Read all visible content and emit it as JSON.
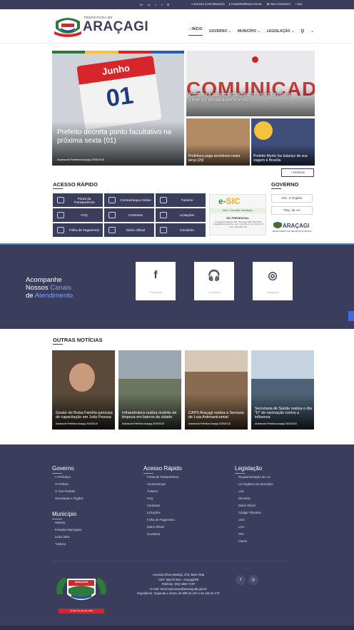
{
  "colors": {
    "brand": "#3a3e5c",
    "accent": "#7da4ff",
    "red": "#d6262b"
  },
  "topbar": {
    "accessibility": [
      "A+",
      "A-",
      "◐",
      "◑",
      "☰"
    ],
    "links": [
      {
        "icon": "info-icon",
        "label": "ACESSO À INFORMAÇÃO"
      },
      {
        "icon": "chart-icon",
        "label": "TRANSPARÊNCIA FISCAL"
      },
      {
        "icon": "phone-icon",
        "label": "FALE CONOSCO"
      },
      {
        "icon": "help-icon",
        "label": "FAQ"
      }
    ]
  },
  "header": {
    "prefix": "PREFEITURA DE",
    "city": "ARAÇAGI",
    "nav": [
      "INÍCIO",
      "GOVERNO",
      "MUNICÍPIO",
      "LEGISLAÇÃO"
    ]
  },
  "hero": {
    "main": {
      "calendar_month": "Junho",
      "calendar_day": "01",
      "title": "Prefeito decreta ponto facultativo na próxima sexta (01)",
      "meta": "Assessoria Prefeitura Araçagi 30/05/2018"
    },
    "right_top": {
      "bg_text": "COMUNICADO",
      "title": "Prefeitura suspende alguns serviços devido a crise do desabastecimento"
    },
    "right_bottom_left": {
      "title": "Prefeitura paga servidores nesta terça (29)"
    },
    "right_bottom_right": {
      "title": "Prefeito Murilo faz balanço de sua viagem à Brasília"
    },
    "all_news": "+ Notícias"
  },
  "acesso_rapido": {
    "title": "ACESSO RÁPIDO",
    "items": [
      {
        "label": "Portal da Transparência",
        "icon": "search-icon"
      },
      {
        "label": "Contracheque Online",
        "icon": "document-icon"
      },
      {
        "label": "Turismo",
        "icon": "suitcase-icon"
      },
      {
        "label": "FAQ",
        "icon": "chat-icon"
      },
      {
        "label": "Contratos",
        "icon": "contract-icon"
      },
      {
        "label": "Licitações",
        "icon": "gavel-icon"
      },
      {
        "label": "Folha de Pagamento",
        "icon": "payroll-icon"
      },
      {
        "label": "Diário Oficial",
        "icon": "book-icon"
      },
      {
        "label": "Ouvidoria",
        "icon": "headset-icon"
      }
    ]
  },
  "esic": {
    "logo_prefix": "e-",
    "logo_main": "SIC",
    "bar": "Abrir / Consultar Solicitação",
    "heading": "SIC PRESENCIAL",
    "address": "Avenida Olívio Marinjá, 278 - Bela Vista CEP: 58270-000 - Araçagi/PB Horário Seg. a Sex.: das 08h às 12h / 14h às 17h Fone: (83) 3502-7107"
  },
  "governo": {
    "title": "GOVERNO",
    "buttons": [
      "Sec. e Órgãos",
      "Reg. da Lei"
    ],
    "arh_name": "ARAÇAGI",
    "arh_desc": "DEPARTAMENTO DE RECURSOS HUMANOS"
  },
  "canais": {
    "line1": "Acompanhe",
    "line2a": "Nossos ",
    "line2b": "Canais",
    "line3a": "de ",
    "line3b": "Atendimento",
    "items": [
      {
        "glyph": "f",
        "label": "Facebook"
      },
      {
        "glyph": "🎧",
        "label": "Ouvidoria"
      },
      {
        "glyph": "◎",
        "label": "Instagram"
      }
    ]
  },
  "outras": {
    "title": "OUTRAS NOTÍCIAS",
    "cards": [
      {
        "title": "Gestor do Bolsa Família participa de capacitação em João Pessoa",
        "meta": "Assessoria Prefeitura Araçagi 24/05/2018",
        "bg": "#5b4a3a"
      },
      {
        "title": "Infraestrutura realiza mutirão de limpeza em bairros da cidade",
        "meta": "Assessoria Prefeitura Araçagi 24/05/2018",
        "bg": "#6b7560"
      },
      {
        "title": "CAPS Araçagi realiza a Semana de Luta Antimanicomial",
        "meta": "Assessoria Prefeitura Araçagi 23/05/2018",
        "bg": "#8a6a50"
      },
      {
        "title": "Secretaria de Saúde realiza o dia \"D\" de vacinação contra a influenza",
        "meta": "Assessoria Prefeitura Araçagi 23/05/2018",
        "bg": "#4d6277"
      }
    ]
  },
  "footer": {
    "governo": {
      "title": "Governo",
      "items": [
        "A Prefeitura",
        "O Prefeito",
        "O Vice-Prefeito",
        "Secretarias e Órgãos"
      ]
    },
    "municipio": {
      "title": "Município",
      "items": [
        "História",
        "Feriados Municipais",
        "Links Úteis",
        "Turismo"
      ]
    },
    "acesso": {
      "title": "Acesso Rápido",
      "items": [
        "Portal da Transparência",
        "Contracheque",
        "Turismo",
        "FAQ",
        "Contratos",
        "Licitações",
        "Folha de Pagamento",
        "Diário Oficial",
        "Ouvidoria"
      ]
    },
    "legislacao": {
      "title": "Legislação",
      "items": [
        "Regulamentação da LAI",
        "Lei Orgânica do Município",
        "Leis",
        "Decretos",
        "Diário Oficial",
        "Código Tributário",
        "LDO",
        "LOA",
        "PPA",
        "CMAS"
      ]
    },
    "seal_name": "ARAÇAGI",
    "seal_date": "02 DE JULHO DE 1956",
    "contact": [
      "Avenida Olívio Marinjá, 278, Bela Vista",
      "CEP: 58270-000 – Araçagi/PB",
      "Telefone: (83) 3502-7107",
      "E-mail: secomunicacao@aracagi.pb.gov.br",
      "Expediente: Segunda a Sexta, de 08h às 12h e de 14h às 17h"
    ],
    "social": [
      "f",
      "◎"
    ]
  }
}
